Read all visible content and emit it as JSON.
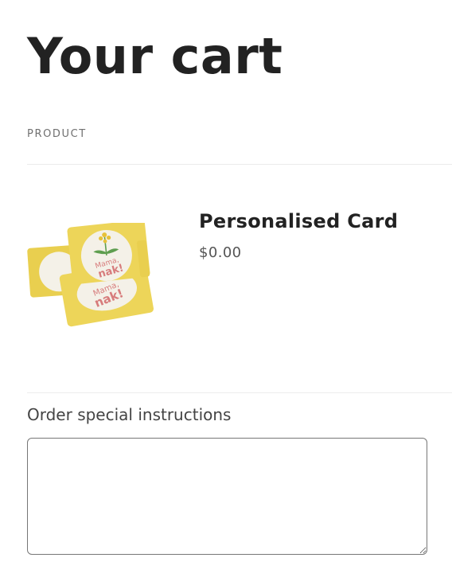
{
  "page": {
    "title": "Your cart"
  },
  "cart": {
    "column_header": "PRODUCT",
    "items": [
      {
        "name": "Personalised Card",
        "price": "$0.00",
        "image_text": [
          "Mama,",
          "nak!"
        ]
      }
    ]
  },
  "instructions": {
    "label": "Order special instructions",
    "value": "",
    "placeholder": ""
  },
  "colors": {
    "card_yellow": "#EDD559",
    "card_circle": "#F4F1E8",
    "text_pink": "#D77C7C",
    "leaf_green": "#5E9E4F",
    "flower_yellow": "#E6C13A"
  }
}
